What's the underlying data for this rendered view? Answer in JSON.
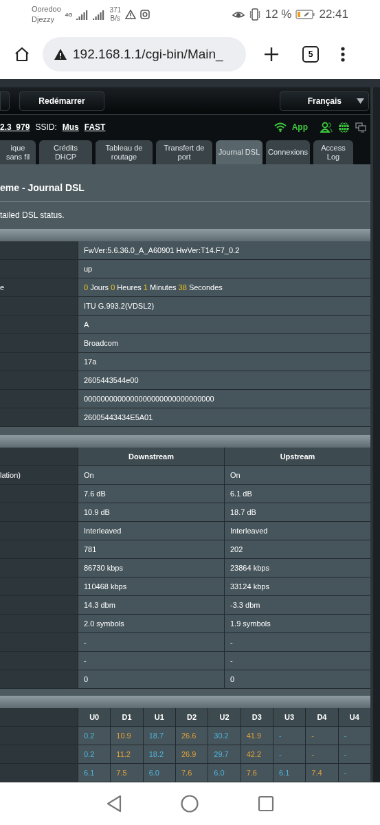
{
  "status_bar": {
    "carriers": [
      "Ooredoo",
      "Djezzy"
    ],
    "network": "4G",
    "speed": "371",
    "speed_unit": "B/s",
    "battery": "12 %",
    "time": "22:41"
  },
  "browser": {
    "url": "192.168.1.1/cgi-bin/Main_",
    "tab_count": "5"
  },
  "router": {
    "reboot_button": "Redémarrer",
    "language": "Français",
    "firmware": "2.3_979",
    "ssid_label": "SSID:",
    "ssids": [
      "Mus",
      "FAST"
    ],
    "app_label": "App",
    "tabs": [
      {
        "label": "ique sans fil",
        "selected": false
      },
      {
        "label": "Crédits DHCP",
        "selected": false
      },
      {
        "label": "Tableau de routage",
        "selected": false
      },
      {
        "label": "Transfert de port",
        "selected": false
      },
      {
        "label": "Journal DSL",
        "selected": true
      },
      {
        "label": "Connexions",
        "selected": false
      },
      {
        "label": "Access Log",
        "selected": false
      }
    ],
    "title": "eme - Journal DSL",
    "description": "tailed DSL status.",
    "info_rows": [
      {
        "value": "FwVer:5.6.36.0_A_A60901 HwVer:T14.F7_0.2"
      },
      {
        "value": "up"
      },
      {
        "label": "e",
        "uptime": [
          {
            "number": "0",
            "unit": "Jours"
          },
          {
            "number": "0",
            "unit": "Heures"
          },
          {
            "number": "1",
            "unit": "Minutes"
          },
          {
            "number": "38",
            "unit": "Secondes"
          }
        ]
      },
      {
        "value": "ITU G.993.2(VDSL2)"
      },
      {
        "value": "A"
      },
      {
        "value": "Broadcom"
      },
      {
        "value": "17a"
      },
      {
        "value": "2605443544e00"
      },
      {
        "value": "0000000000000000000000000000000"
      },
      {
        "value": "26005443434E5A01"
      }
    ],
    "stream_columns": [
      "Downstream",
      "Upstream"
    ],
    "stream_rows": [
      {
        "label": "lation)",
        "values": [
          "On",
          "On"
        ]
      },
      {
        "values": [
          "7.6 dB",
          "6.1 dB"
        ]
      },
      {
        "values": [
          "10.9 dB",
          "18.7 dB"
        ]
      },
      {
        "values": [
          "Interleaved",
          "Interleaved"
        ]
      },
      {
        "values": [
          "781",
          "202"
        ]
      },
      {
        "values": [
          "86730 kbps",
          "23864 kbps"
        ]
      },
      {
        "values": [
          "110468 kbps",
          "33124 kbps"
        ]
      },
      {
        "values": [
          "14.3 dbm",
          "-3.3 dbm"
        ]
      },
      {
        "values": [
          "2.0 symbols",
          "1.9 symbols"
        ]
      },
      {
        "values": [
          "-",
          "-"
        ]
      },
      {
        "values": [
          "-",
          "-"
        ]
      },
      {
        "values": [
          "0",
          "0"
        ]
      }
    ],
    "band_columns": [
      {
        "label": "U0",
        "kind": "up"
      },
      {
        "label": "D1",
        "kind": "down"
      },
      {
        "label": "U1",
        "kind": "up"
      },
      {
        "label": "D2",
        "kind": "down"
      },
      {
        "label": "U2",
        "kind": "up"
      },
      {
        "label": "D3",
        "kind": "down"
      },
      {
        "label": "U3",
        "kind": "up"
      },
      {
        "label": "D4",
        "kind": "down"
      },
      {
        "label": "U4",
        "kind": "up"
      }
    ],
    "band_rows": [
      [
        "0.2",
        "10.9",
        "18.7",
        "26.6",
        "30.2",
        "41.9",
        "-",
        "-",
        "-"
      ],
      [
        "0.2",
        "11.2",
        "18.2",
        "26.9",
        "29.7",
        "42.2",
        "-",
        "-",
        "-"
      ],
      [
        "6.1",
        "7.5",
        "6.0",
        "7.6",
        "6.0",
        "7.6",
        "6.1",
        "7.4",
        "-"
      ]
    ]
  }
}
